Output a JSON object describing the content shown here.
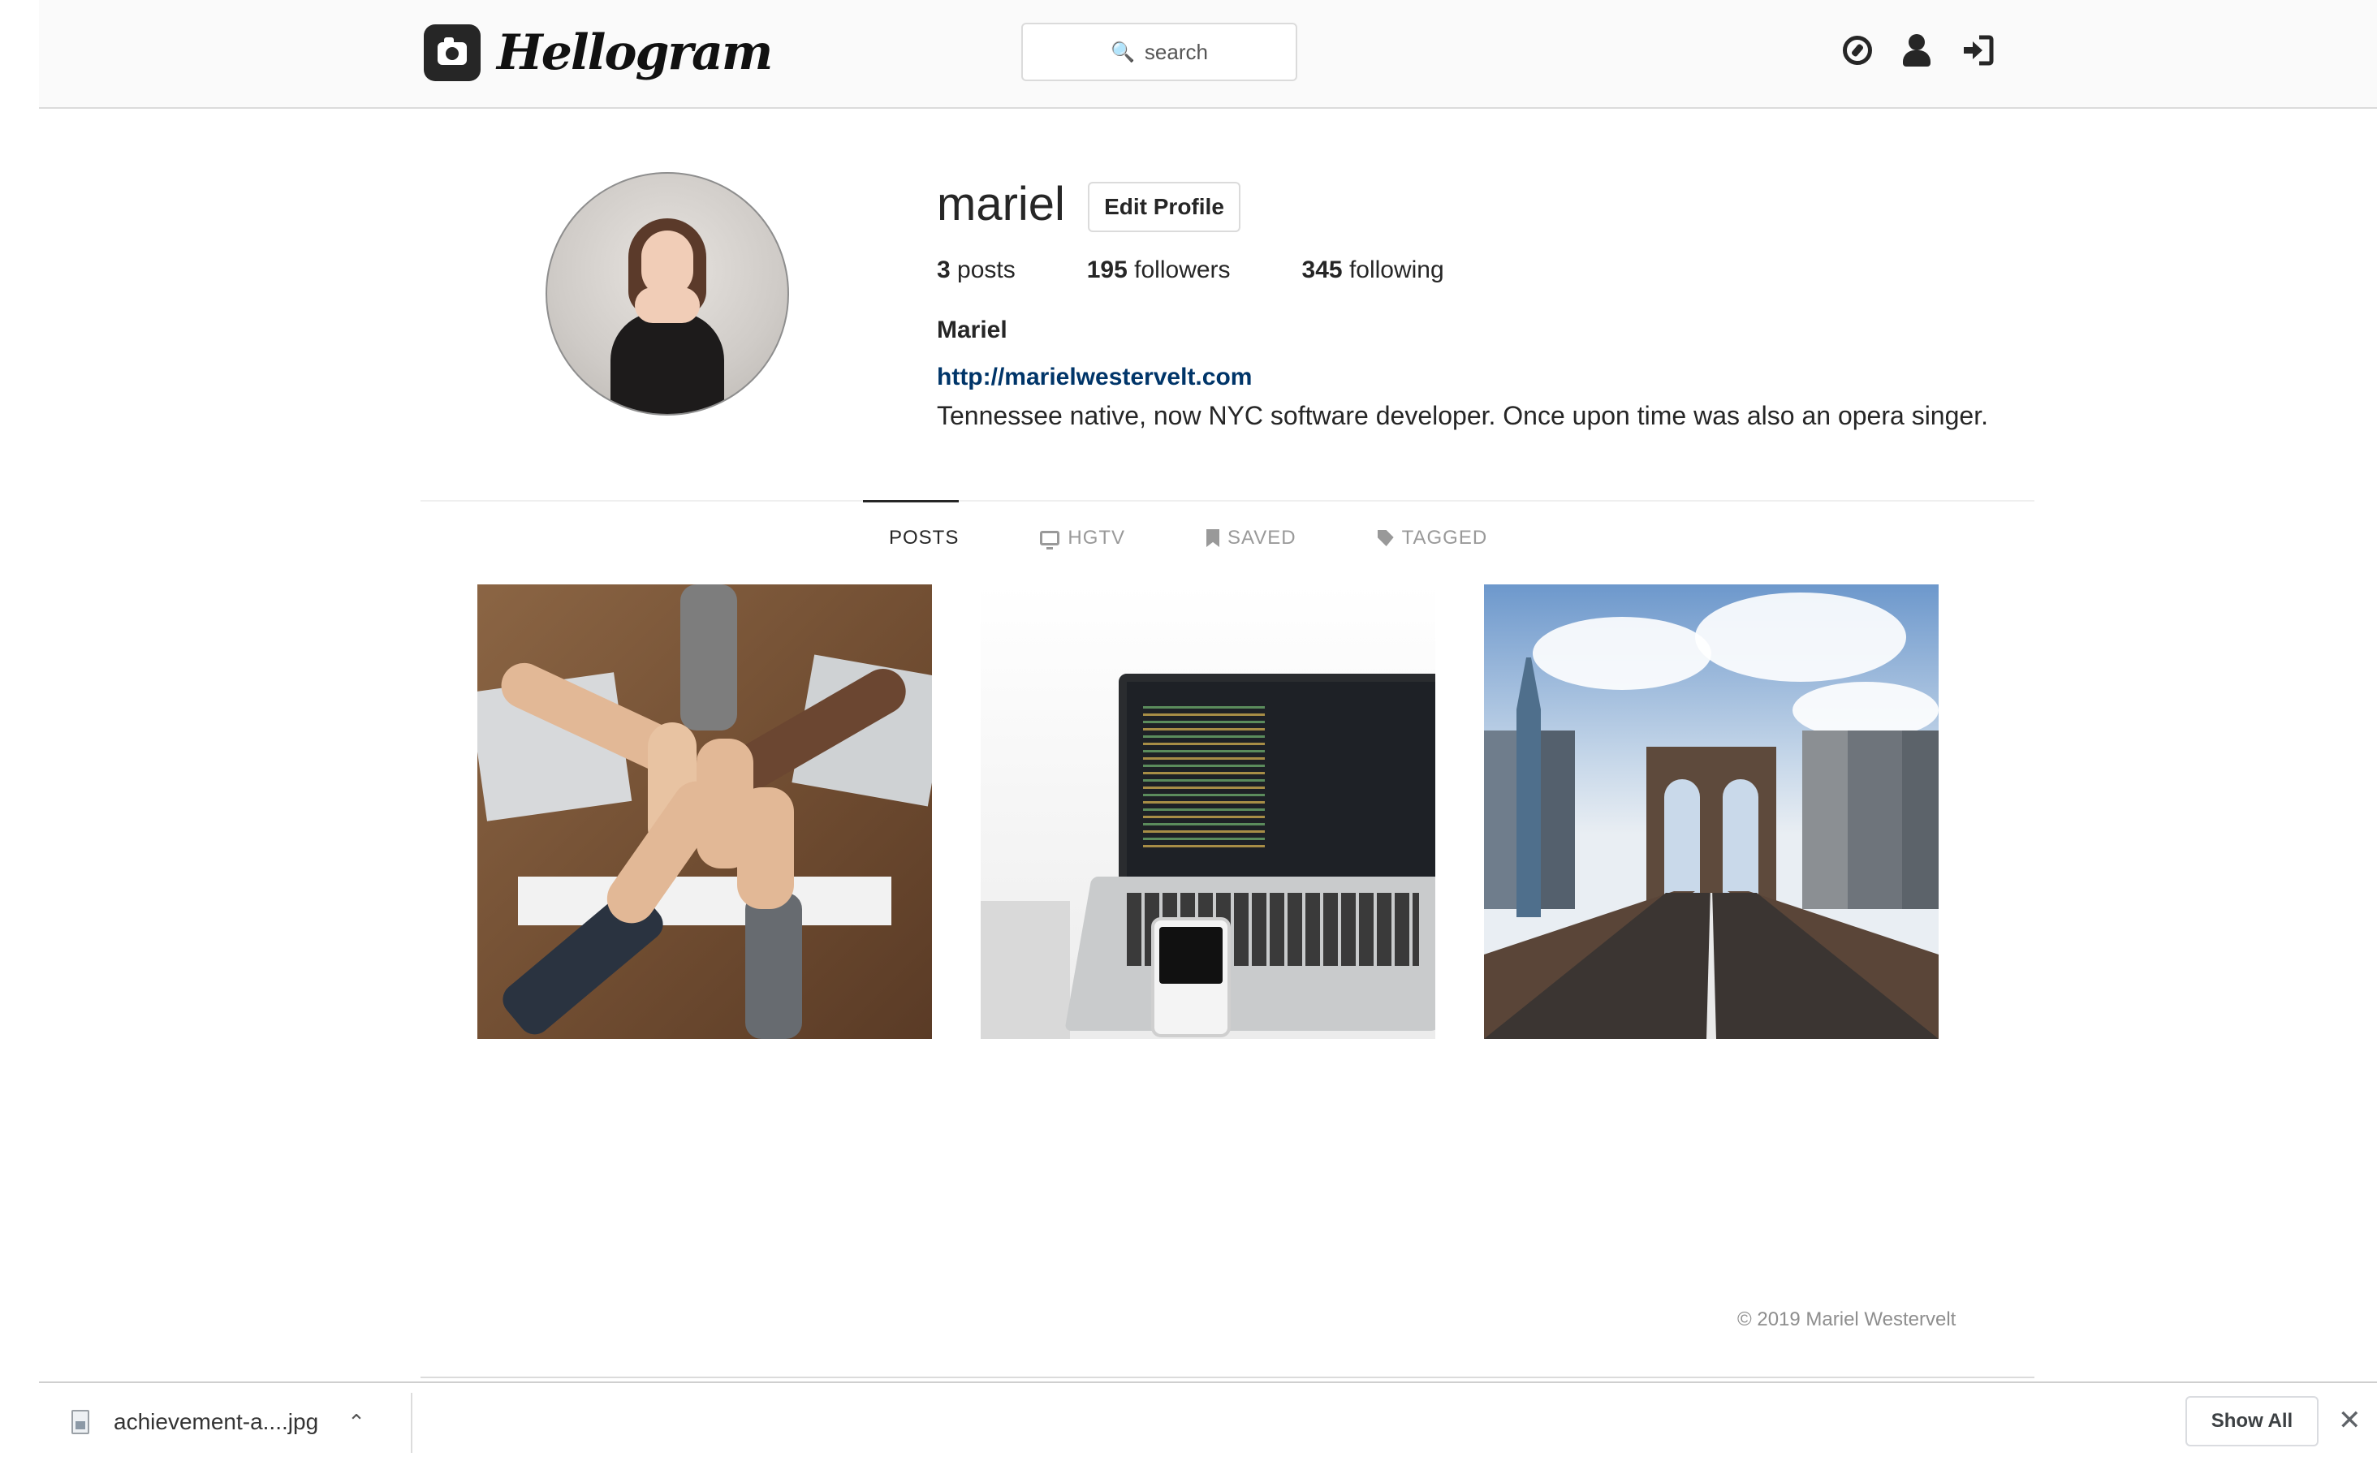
{
  "header": {
    "logo_text": "Hellogram",
    "search_placeholder": "search",
    "icons": [
      "compass-icon",
      "user-icon",
      "sign-in-icon"
    ]
  },
  "profile": {
    "username": "mariel",
    "edit_button": "Edit Profile",
    "stats": {
      "posts_count": "3",
      "posts_label": "posts",
      "followers_count": "195",
      "followers_label": "followers",
      "following_count": "345",
      "following_label": "following"
    },
    "full_name": "Mariel",
    "website": "http://marielwestervelt.com",
    "bio": "Tennessee native, now NYC software developer. Once upon time was also an opera singer."
  },
  "tabs": [
    {
      "label": "POSTS",
      "icon": "grid-icon",
      "active": true
    },
    {
      "label": "HGTV",
      "icon": "tv-icon",
      "active": false
    },
    {
      "label": "SAVED",
      "icon": "bookmark-icon",
      "active": false
    },
    {
      "label": "TAGGED",
      "icon": "tag-icon",
      "active": false
    }
  ],
  "posts": [
    "hands-together-photo",
    "laptop-code-photo",
    "brooklyn-bridge-photo"
  ],
  "footer": {
    "copyright": "© 2019 Mariel Westervelt"
  },
  "download_bar": {
    "file_name": "achievement-a....jpg",
    "show_all": "Show All"
  },
  "colors": {
    "link": "#003569",
    "text": "#262626",
    "muted": "#999999",
    "border": "#dbdbdb",
    "header_bg": "#fafafa"
  }
}
